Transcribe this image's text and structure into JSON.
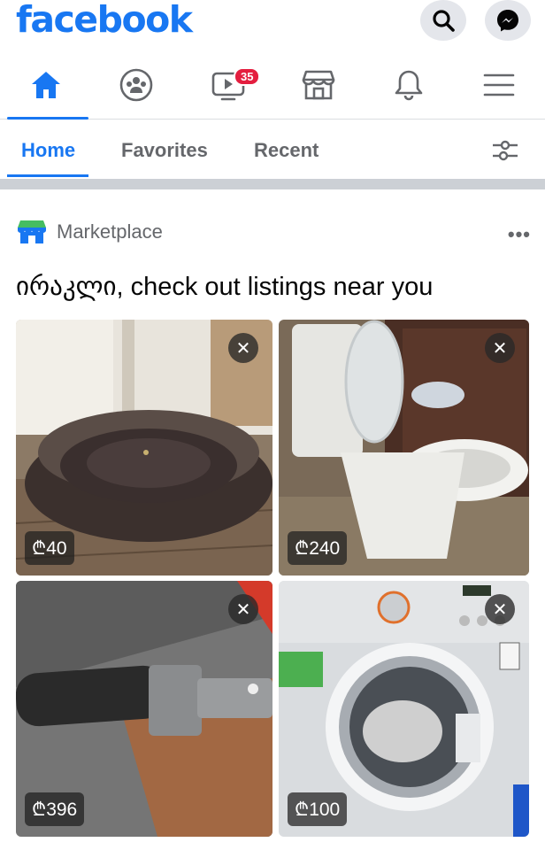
{
  "header": {
    "logo": "facebook",
    "search_icon": "search-icon",
    "messenger_icon": "messenger-icon"
  },
  "nav": {
    "items": [
      {
        "name": "home",
        "icon": "home-icon"
      },
      {
        "name": "groups",
        "icon": "groups-icon"
      },
      {
        "name": "watch",
        "icon": "watch-icon",
        "badge": "35"
      },
      {
        "name": "marketplace",
        "icon": "marketplace-icon"
      },
      {
        "name": "notifications",
        "icon": "bell-icon"
      },
      {
        "name": "menu",
        "icon": "menu-icon"
      }
    ]
  },
  "subtabs": {
    "home": "Home",
    "favorites": "Favorites",
    "recent": "Recent",
    "filter_icon": "filter-icon"
  },
  "marketplace": {
    "label": "Marketplace",
    "more": "•••",
    "headline": "ირაკლი, check out listings near you",
    "listings": [
      {
        "price": "₾40"
      },
      {
        "price": "₾240"
      },
      {
        "price": "₾396"
      },
      {
        "price": "₾100"
      }
    ],
    "dismiss": "✕"
  },
  "colors": {
    "accent": "#1877f2",
    "badge": "#e41e3f",
    "secondary_text": "#65676b"
  }
}
